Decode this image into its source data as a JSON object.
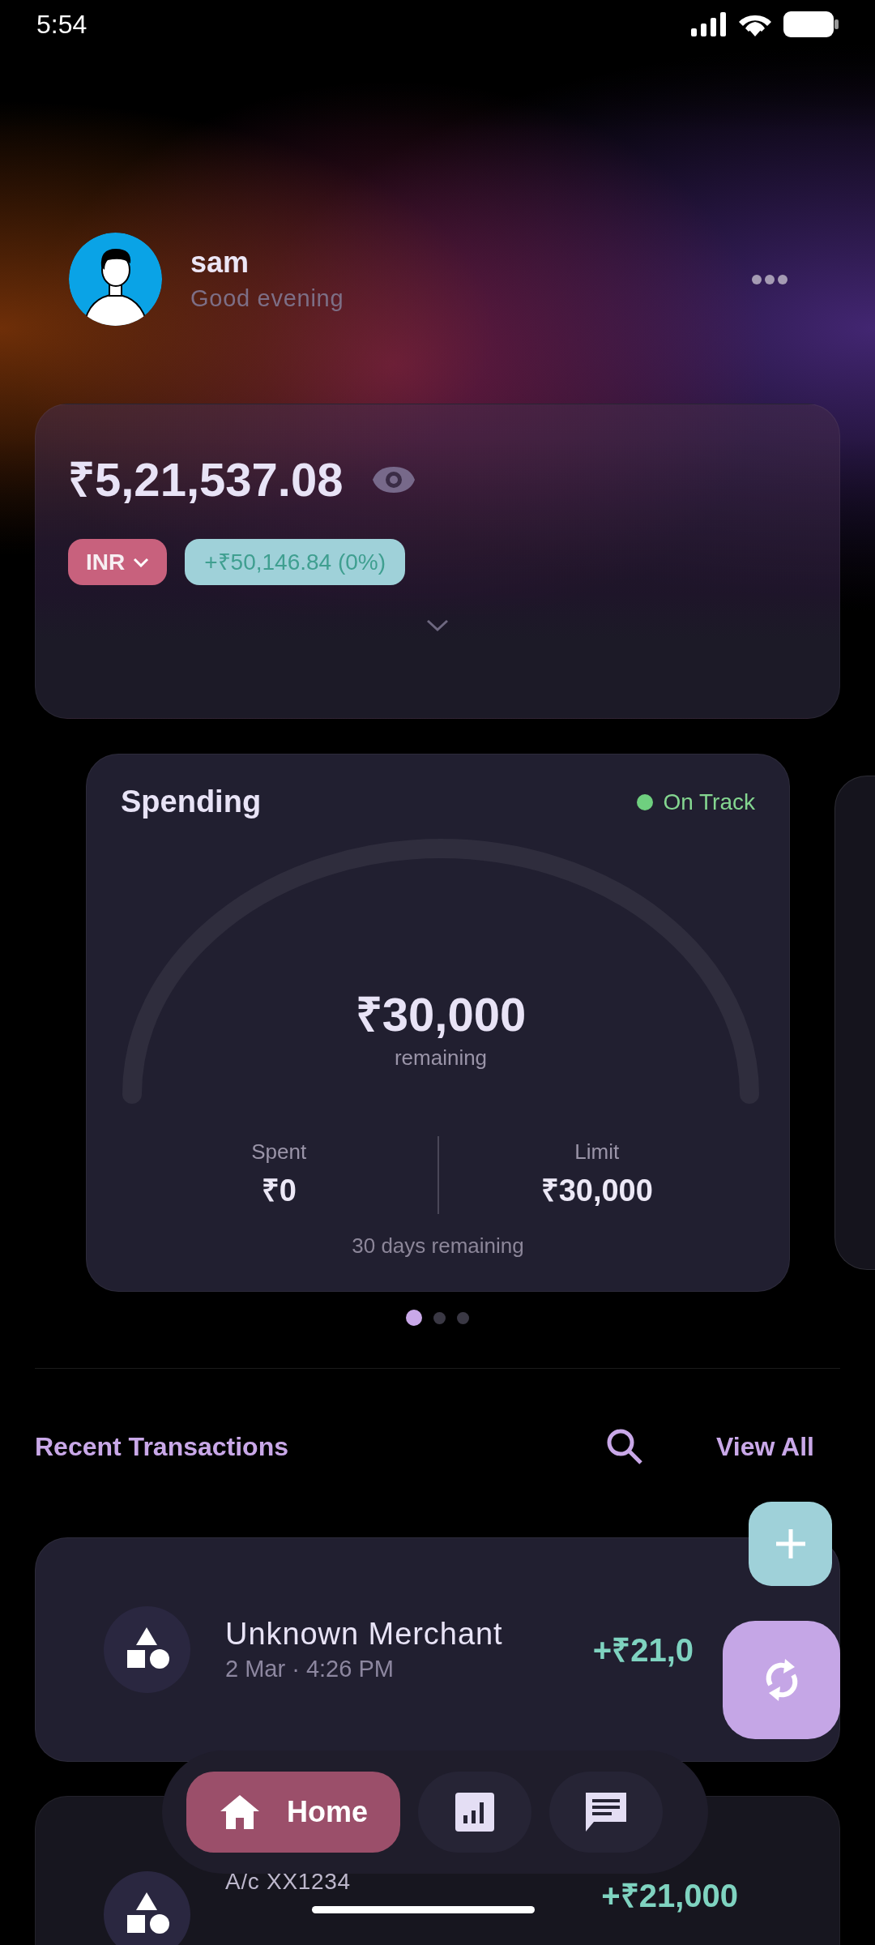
{
  "status_bar": {
    "time": "5:54"
  },
  "profile": {
    "name": "sam",
    "greeting": "Good evening"
  },
  "balance": {
    "amount": "₹5,21,537.08",
    "currency": "INR",
    "change": "+₹50,146.84 (0%)"
  },
  "spending": {
    "title": "Spending",
    "status": "On Track",
    "remaining_amount": "₹30,000",
    "remaining_label": "remaining",
    "spent_label": "Spent",
    "spent_value": "₹0",
    "limit_label": "Limit",
    "limit_value": "₹30,000",
    "days_left": "30 days remaining"
  },
  "page_dots": [
    {
      "selected": true
    },
    {
      "selected": false
    },
    {
      "selected": false
    }
  ],
  "transactions_header": {
    "title": "Recent Transactions",
    "view_all": "View All"
  },
  "transactions": [
    {
      "name": "Unknown Merchant",
      "date": "2 Mar · 4:26 PM",
      "amount": "+₹21,0",
      "faded": false
    },
    {
      "name": "A/c XX1234",
      "amount": "+₹21,000",
      "faded": true
    }
  ],
  "nav": [
    {
      "kind": "home",
      "label": "Home",
      "selected": true
    },
    {
      "kind": "chart",
      "selected": false
    },
    {
      "kind": "chat",
      "selected": false
    }
  ]
}
